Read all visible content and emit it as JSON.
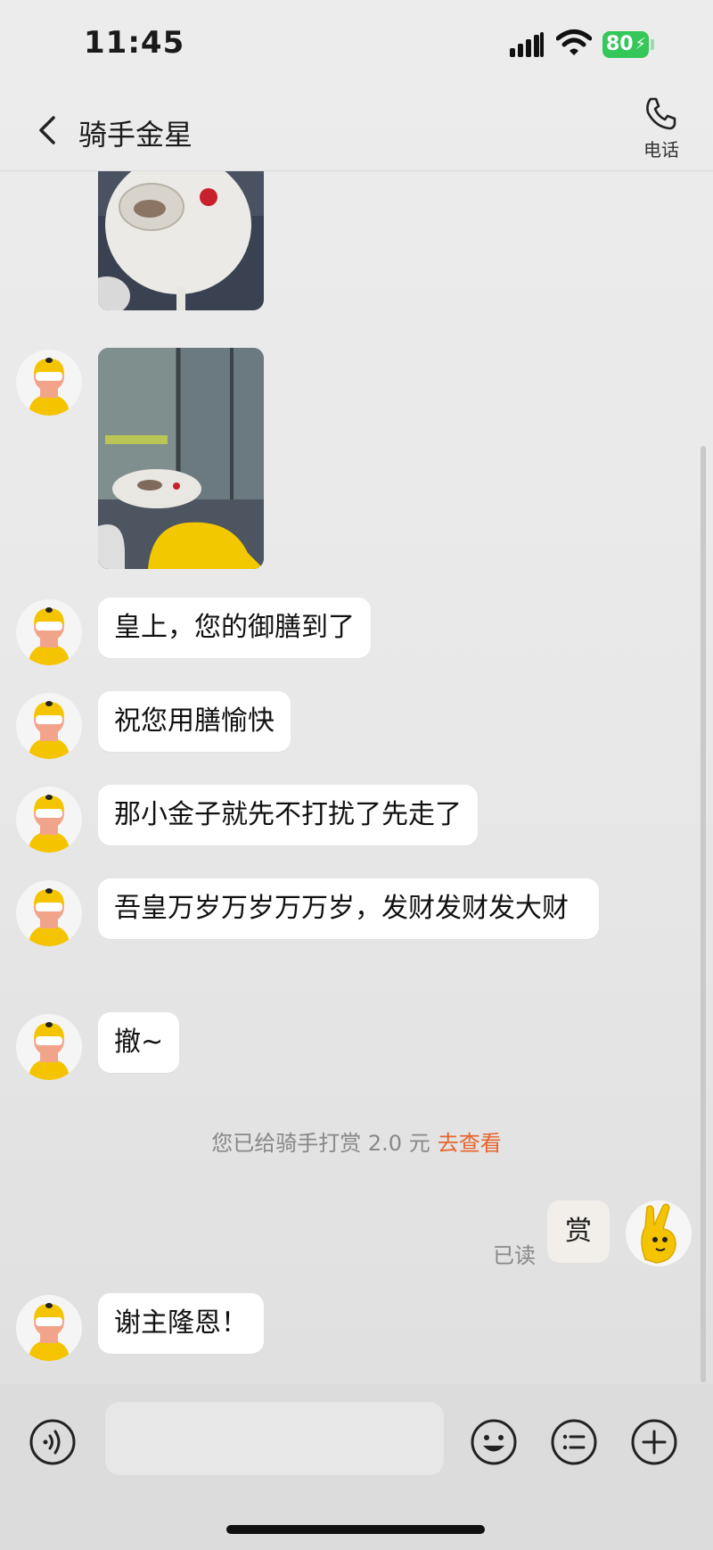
{
  "status_bar": {
    "time": "11:45",
    "battery": "80"
  },
  "header": {
    "title": "骑手金星",
    "call_label": "电话"
  },
  "messages": [
    {
      "text": "皇上，您的御膳到了"
    },
    {
      "text": "祝您用膳愉快"
    },
    {
      "text": "那小金子就先不打扰了先走了"
    },
    {
      "text": "吾皇万岁万岁万万岁，发财发财发大财"
    },
    {
      "text": "撤~"
    },
    {
      "text": "谢主隆恩！"
    }
  ],
  "system_note": {
    "text": "您已给骑手打赏 2.0 元",
    "link": "去查看"
  },
  "my_message": {
    "text": "赏",
    "status": "已读"
  },
  "input": {
    "placeholder": ""
  },
  "icons": {
    "back": "chevron-left-icon",
    "call": "phone-icon",
    "voice": "voice-icon",
    "emoji": "emoji-icon",
    "list": "list-icon",
    "plus": "plus-icon"
  },
  "colors": {
    "accent_link": "#e8632b",
    "battery": "#35c759",
    "rider_yellow": "#f5c400"
  }
}
